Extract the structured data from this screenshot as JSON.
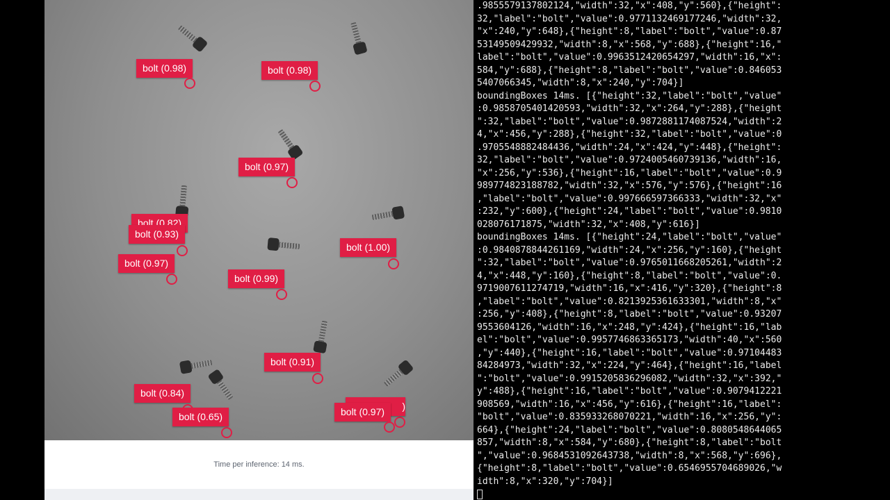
{
  "viewer": {
    "status_text": "Time per inference: 14 ms.",
    "accent_color": "#e01e45",
    "detections": [
      {
        "label": "bolt (0.98)"
      },
      {
        "label": "bolt (0.98)"
      },
      {
        "label": "bolt (0.97)"
      },
      {
        "label": "bolt (0.82)"
      },
      {
        "label": "bolt (0.93)"
      },
      {
        "label": "bolt (0.97)"
      },
      {
        "label": "bolt (1.00)"
      },
      {
        "label": "bolt (0.99)"
      },
      {
        "label": "bolt (0.91)"
      },
      {
        "label": "bolt (0.84)"
      },
      {
        "label": "bolt (0.65)"
      },
      {
        "label": "bolt (0.97)"
      }
    ]
  },
  "terminal": {
    "lines": [
      ".9855579137802124,\"width\":32,\"x\":408,\"y\":560},{\"height\":",
      "32,\"label\":\"bolt\",\"value\":0.9771132469177246,\"width\":32,",
      "\"x\":240,\"y\":648},{\"height\":8,\"label\":\"bolt\",\"value\":0.87",
      "53149509429932,\"width\":8,\"x\":568,\"y\":688},{\"height\":16,\"",
      "label\":\"bolt\",\"value\":0.9963512420654297,\"width\":16,\"x\":",
      "584,\"y\":688},{\"height\":8,\"label\":\"bolt\",\"value\":0.846053",
      "5407066345,\"width\":8,\"x\":240,\"y\":704}]",
      "boundingBoxes 14ms. [{\"height\":32,\"label\":\"bolt\",\"value\"",
      ":0.9858705401420593,\"width\":32,\"x\":264,\"y\":288},{\"height",
      "\":32,\"label\":\"bolt\",\"value\":0.9872881174087524,\"width\":2",
      "4,\"x\":456,\"y\":288},{\"height\":32,\"label\":\"bolt\",\"value\":0",
      ".9705548882484436,\"width\":24,\"x\":424,\"y\":448},{\"height\":",
      "32,\"label\":\"bolt\",\"value\":0.9724005460739136,\"width\":16,",
      "\"x\":256,\"y\":536},{\"height\":16,\"label\":\"bolt\",\"value\":0.9",
      "989774823188782,\"width\":32,\"x\":576,\"y\":576},{\"height\":16",
      ",\"label\":\"bolt\",\"value\":0.997666597366333,\"width\":32,\"x\"",
      ":232,\"y\":600},{\"height\":24,\"label\":\"bolt\",\"value\":0.9810",
      "028076171875,\"width\":32,\"x\":408,\"y\":616}]",
      "boundingBoxes 14ms. [{\"height\":24,\"label\":\"bolt\",\"value\"",
      ":0.9840878844261169,\"width\":24,\"x\":256,\"y\":160},{\"height",
      "\":32,\"label\":\"bolt\",\"value\":0.9765011668205261,\"width\":2",
      "4,\"x\":448,\"y\":160},{\"height\":8,\"label\":\"bolt\",\"value\":0.",
      "9719007611274719,\"width\":16,\"x\":416,\"y\":320},{\"height\":8",
      ",\"label\":\"bolt\",\"value\":0.8213925361633301,\"width\":8,\"x\"",
      ":256,\"y\":408},{\"height\":8,\"label\":\"bolt\",\"value\":0.93207",
      "9553604126,\"width\":16,\"x\":248,\"y\":424},{\"height\":16,\"lab",
      "el\":\"bolt\",\"value\":0.9957746863365173,\"width\":40,\"x\":560",
      ",\"y\":440},{\"height\":16,\"label\":\"bolt\",\"value\":0.97104483",
      "84284973,\"width\":32,\"x\":224,\"y\":464},{\"height\":16,\"label",
      "\":\"bolt\",\"value\":0.9915205836296082,\"width\":32,\"x\":392,\"",
      "y\":488},{\"height\":16,\"label\":\"bolt\",\"value\":0.9079412221",
      "908569,\"width\":16,\"x\":456,\"y\":616},{\"height\":16,\"label\":",
      "\"bolt\",\"value\":0.835933268070221,\"width\":16,\"x\":256,\"y\":",
      "664},{\"height\":24,\"label\":\"bolt\",\"value\":0.8080548644065",
      "857,\"width\":8,\"x\":584,\"y\":680},{\"height\":8,\"label\":\"bolt",
      "\",\"value\":0.9684531092643738,\"width\":8,\"x\":568,\"y\":696},",
      "{\"height\":8,\"label\":\"bolt\",\"value\":0.6546955704689026,\"w",
      "idth\":8,\"x\":320,\"y\":704}]"
    ]
  }
}
